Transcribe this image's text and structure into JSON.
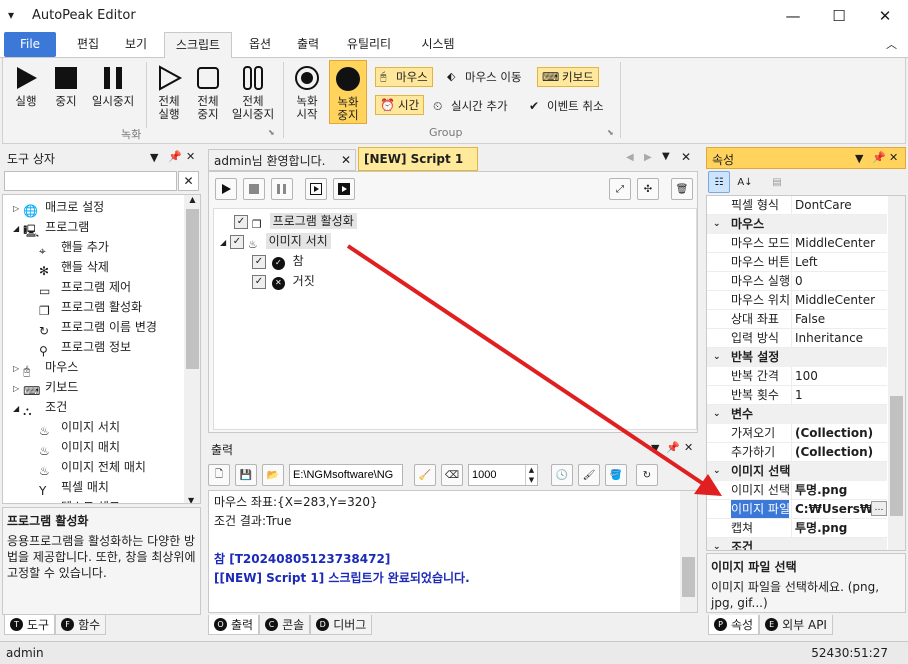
{
  "window": {
    "title": "AutoPeak Editor",
    "menu_icon": "▾",
    "min": "—",
    "max": "☐",
    "close": "✕"
  },
  "menu": {
    "tabs": [
      "File",
      "편집",
      "보기",
      "스크립트",
      "옵션",
      "출력",
      "유틸리티",
      "시스템"
    ],
    "collapse": "︿"
  },
  "ribbon": {
    "rec": [
      {
        "label": "실행",
        "icon": "play-icon"
      },
      {
        "label": "중지",
        "icon": "stop-icon"
      },
      {
        "label": "일시중지",
        "icon": "pause-icon"
      }
    ],
    "all": [
      {
        "label": "전체\n실행",
        "icon": "play-outline-icon"
      },
      {
        "label": "전체\n중지",
        "icon": "stop-outline-icon"
      },
      {
        "label": "전체\n일시중지",
        "icon": "pause-outline-icon"
      }
    ],
    "record_start": "녹화\n시작",
    "record_stop": "녹화\n중지",
    "group_rec": "녹화",
    "group_group": "Group",
    "small": {
      "mouse": "마우스",
      "mouse_move": "마우스 이동",
      "keyboard": "키보드",
      "time": "시간",
      "realtime_add": "실시간 추가",
      "event_cancel": "이벤트 취소"
    }
  },
  "toolbox": {
    "title": "도구 상자",
    "search_value": "",
    "search_clear": "✕",
    "items": [
      {
        "label": "매크로 설정",
        "level": 0,
        "exp": "▷"
      },
      {
        "label": "프로그램",
        "level": 0,
        "exp": "◢"
      },
      {
        "label": "핸들 추가",
        "level": 1
      },
      {
        "label": "핸들 삭제",
        "level": 1
      },
      {
        "label": "프로그램 제어",
        "level": 1
      },
      {
        "label": "프로그램 활성화",
        "level": 1
      },
      {
        "label": "프로그램 이름 변경",
        "level": 1
      },
      {
        "label": "프로그램 정보",
        "level": 1
      },
      {
        "label": "마우스",
        "level": 0,
        "exp": "▷"
      },
      {
        "label": "키보드",
        "level": 0,
        "exp": "▷"
      },
      {
        "label": "조건",
        "level": 0,
        "exp": "◢"
      },
      {
        "label": "이미지 서치",
        "level": 1
      },
      {
        "label": "이미지 매치",
        "level": 1
      },
      {
        "label": "이미지 전체 매치",
        "level": 1
      },
      {
        "label": "픽셀 매치",
        "level": 1
      },
      {
        "label": "텍스트 체크",
        "level": 1
      }
    ],
    "desc_title": "프로그램 활성화",
    "desc_text": "응용프로그램을 활성화하는 다양한 방법을 제공합니다. 또한, 창을 최상위에 고정할 수 있습니다.",
    "tabs": [
      "도구",
      "함수"
    ]
  },
  "editor": {
    "tabs": [
      "admin님 환영합니다.",
      "[NEW] Script 1"
    ],
    "tab_close": "✕",
    "tree": [
      {
        "label": "프로그램 활성화",
        "level": 0
      },
      {
        "label": "이미지 서치",
        "level": 0
      },
      {
        "label": "참",
        "level": 1
      },
      {
        "label": "거짓",
        "level": 1
      }
    ]
  },
  "output": {
    "title": "출력",
    "path": "E:\\NGMsoftware\\NG",
    "number": "1000",
    "lines": [
      {
        "text": "마우스 좌표:{X=283,Y=320}",
        "style": "normal"
      },
      {
        "text": "조건 결과:True",
        "style": "normal"
      },
      {
        "text": "",
        "style": "normal"
      },
      {
        "text": "참 [T20240805123738472]",
        "style": "blue"
      },
      {
        "text": "[[NEW] Script 1] 스크립트가 완료되었습니다.",
        "style": "blue"
      }
    ],
    "tabs": [
      "출력",
      "콘솔",
      "디버그"
    ]
  },
  "properties": {
    "title": "속성",
    "rows": [
      {
        "type": "row",
        "k": "픽셀 형식",
        "v": "DontCare"
      },
      {
        "type": "cat",
        "k": "마우스"
      },
      {
        "type": "row",
        "k": "마우스 모드",
        "v": "MiddleCenter"
      },
      {
        "type": "row",
        "k": "마우스 버튼",
        "v": "Left"
      },
      {
        "type": "row",
        "k": "마우스 실행",
        "v": "0"
      },
      {
        "type": "row",
        "k": "마우스 위치",
        "v": "MiddleCenter"
      },
      {
        "type": "row",
        "k": "상대 좌표",
        "v": "False"
      },
      {
        "type": "row",
        "k": "입력 방식",
        "v": "Inheritance"
      },
      {
        "type": "cat",
        "k": "반복 설정"
      },
      {
        "type": "row",
        "k": "반복 간격",
        "v": "100"
      },
      {
        "type": "row",
        "k": "반복 횟수",
        "v": "1"
      },
      {
        "type": "cat",
        "k": "변수"
      },
      {
        "type": "row",
        "k": "가져오기",
        "v": "(Collection)",
        "bold": true
      },
      {
        "type": "row",
        "k": "추가하기",
        "v": "(Collection)",
        "bold": true
      },
      {
        "type": "cat",
        "k": "이미지 선택"
      },
      {
        "type": "row",
        "k": "이미지 선택",
        "v": "투명.png",
        "bold": true
      },
      {
        "type": "row",
        "k": "이미지 파일",
        "v": "C:₩Users₩ngm",
        "bold": true,
        "selected": true
      },
      {
        "type": "row",
        "k": "캡쳐",
        "v": "투명.png",
        "bold": true
      },
      {
        "type": "cat",
        "k": "조건"
      }
    ],
    "desc_title": "이미지 파일 선택",
    "desc_text": "이미지 파일을 선택하세요. (png, jpg, gif...)",
    "tabs": [
      "속성",
      "외부 API"
    ]
  },
  "status": {
    "user": "admin",
    "time": "52430:51:27"
  }
}
